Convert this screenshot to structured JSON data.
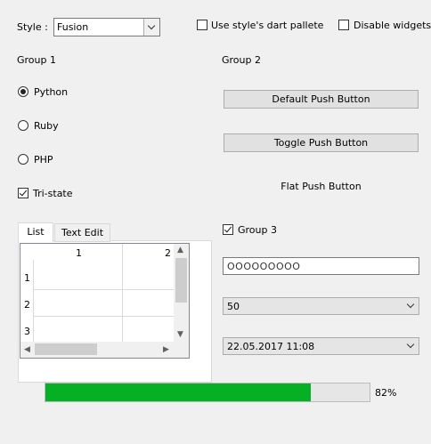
{
  "header": {
    "style_label": "Style :",
    "style_value": "Fusion",
    "use_palette_label": "Use style's dart pallete",
    "use_palette_checked": false,
    "disable_widgets_label": "Disable widgets",
    "disable_widgets_checked": false
  },
  "group1": {
    "title": "Group 1",
    "radios": [
      {
        "label": "Python",
        "checked": true
      },
      {
        "label": "Ruby",
        "checked": false
      },
      {
        "label": "PHP",
        "checked": false
      }
    ],
    "tristate_label": "Tri-state",
    "tristate_checked": true
  },
  "group2": {
    "title": "Group 2",
    "default_button": "Default Push Button",
    "toggle_button": "Toggle Push Button",
    "flat_button": "Flat Push Button"
  },
  "tabs": {
    "items": [
      {
        "label": "List",
        "active": true
      },
      {
        "label": "Text Edit",
        "active": false
      }
    ],
    "table": {
      "column_headers": [
        "1",
        "2"
      ],
      "row_headers": [
        "1",
        "2",
        "3"
      ]
    }
  },
  "group3": {
    "title": "Group 3",
    "checked": true,
    "password_value": "OOOOOOOOO",
    "spin_value": "50",
    "datetime_value": "22.05.2017 11:08"
  },
  "progress": {
    "value": 82,
    "text": "82%",
    "color": "#06b025"
  }
}
